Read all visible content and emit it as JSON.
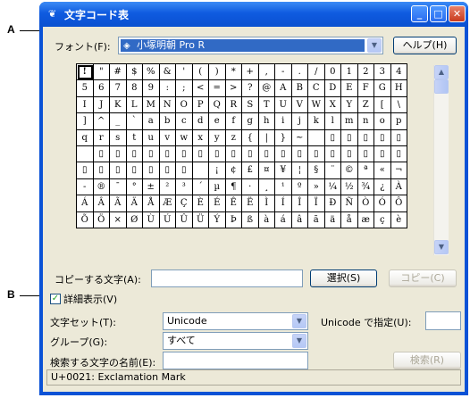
{
  "callouts": {
    "a": "A",
    "b": "B"
  },
  "window": {
    "title": "文字コード表"
  },
  "font": {
    "label": "フォント(F):",
    "selected": "小塚明朝 Pro R"
  },
  "help_button": "ヘルプ(H)",
  "grid": [
    [
      "!",
      "\"",
      "#",
      "$",
      "%",
      "&",
      "'",
      "(",
      ")",
      "*",
      "+",
      ",",
      "-",
      ".",
      "/",
      "0",
      "1",
      "2",
      "3",
      "4"
    ],
    [
      "5",
      "6",
      "7",
      "8",
      "9",
      ":",
      ";",
      "<",
      "=",
      ">",
      "?",
      "@",
      "A",
      "B",
      "C",
      "D",
      "E",
      "F",
      "G",
      "H"
    ],
    [
      "I",
      "J",
      "K",
      "L",
      "M",
      "N",
      "O",
      "P",
      "Q",
      "R",
      "S",
      "T",
      "U",
      "V",
      "W",
      "X",
      "Y",
      "Z",
      "[",
      "\\"
    ],
    [
      "]",
      "^",
      "_",
      "`",
      "a",
      "b",
      "c",
      "d",
      "e",
      "f",
      "g",
      "h",
      "i",
      "j",
      "k",
      "l",
      "m",
      "n",
      "o",
      "p"
    ],
    [
      "q",
      "r",
      "s",
      "t",
      "u",
      "v",
      "w",
      "x",
      "y",
      "z",
      "{",
      "|",
      "}",
      "~",
      "",
      "▯",
      "▯",
      "▯",
      "▯",
      "▯"
    ],
    [
      "",
      "▯",
      "▯",
      "▯",
      "▯",
      "▯",
      "▯",
      "▯",
      "▯",
      "▯",
      "▯",
      "▯",
      "▯",
      "▯",
      "▯",
      "▯",
      "▯",
      "▯",
      "▯",
      "▯"
    ],
    [
      "▯",
      "▯",
      "▯",
      "▯",
      "▯",
      "▯",
      "▯",
      "",
      "¡",
      "¢",
      "£",
      "¤",
      "¥",
      "¦",
      "§",
      "¨",
      "©",
      "ª",
      "«",
      "¬"
    ],
    [
      "-",
      "®",
      "¯",
      "°",
      "±",
      "²",
      "³",
      "´",
      "µ",
      "¶",
      "·",
      "¸",
      "¹",
      "º",
      "»",
      "¼",
      "½",
      "¾",
      "¿",
      "À"
    ],
    [
      "Á",
      "Â",
      "Ã",
      "Ä",
      "Å",
      "Æ",
      "Ç",
      "È",
      "É",
      "Ê",
      "Ë",
      "Ì",
      "Í",
      "Î",
      "Ï",
      "Ð",
      "Ñ",
      "Ò",
      "Ó",
      "Ô"
    ],
    [
      "Õ",
      "Ö",
      "×",
      "Ø",
      "Ù",
      "Ú",
      "Û",
      "Ü",
      "Ý",
      "Þ",
      "ß",
      "à",
      "á",
      "â",
      "ã",
      "ä",
      "å",
      "æ",
      "ç",
      "è"
    ]
  ],
  "copy": {
    "label": "コピーする文字(A):",
    "value": "",
    "select_button": "選択(S)",
    "copy_button": "コピー(C)"
  },
  "details": {
    "label": "詳細表示(V)",
    "checked": true
  },
  "charset": {
    "label": "文字セット(T):",
    "value": "Unicode",
    "goto_label": "Unicode で指定(U):",
    "goto_value": ""
  },
  "group": {
    "label": "グループ(G):",
    "value": "すべて"
  },
  "search": {
    "label": "検索する文字の名前(E):",
    "value": "",
    "button": "検索(R)"
  },
  "status": "U+0021: Exclamation Mark"
}
